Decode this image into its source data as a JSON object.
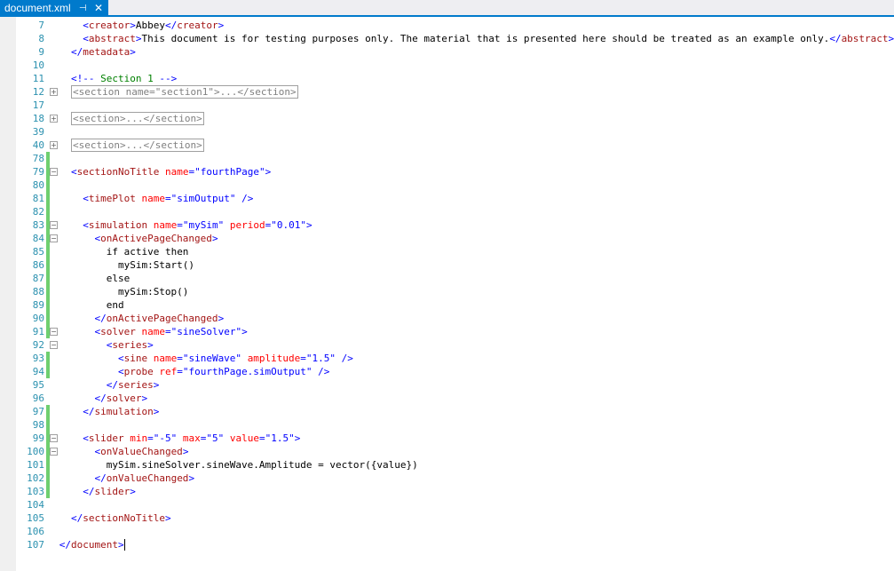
{
  "tab": {
    "title": "document.xml",
    "pin": "⊣",
    "close": "✕"
  },
  "lines": [
    {
      "n": "7",
      "indent": 1,
      "change": false,
      "fold": "",
      "tokens": [
        [
          "br",
          "<"
        ],
        [
          "tag",
          "creator"
        ],
        [
          "br",
          ">"
        ],
        [
          "txt",
          "Abbey"
        ],
        [
          "br",
          "</"
        ],
        [
          "tag",
          "creator"
        ],
        [
          "br",
          ">"
        ]
      ]
    },
    {
      "n": "8",
      "indent": 1,
      "change": false,
      "fold": "",
      "tokens": [
        [
          "br",
          "<"
        ],
        [
          "tag",
          "abstract"
        ],
        [
          "br",
          ">"
        ],
        [
          "txt",
          "This document is for testing purposes only. The material that is presented here should be treated as an example only."
        ],
        [
          "br",
          "</"
        ],
        [
          "tag",
          "abstract"
        ],
        [
          "br",
          ">"
        ]
      ]
    },
    {
      "n": "9",
      "indent": 0,
      "change": false,
      "fold": "",
      "tokens": [
        [
          "br",
          "</"
        ],
        [
          "tag",
          "metadata"
        ],
        [
          "br",
          ">"
        ]
      ]
    },
    {
      "n": "10",
      "indent": 0,
      "change": false,
      "fold": "",
      "tokens": []
    },
    {
      "n": "11",
      "indent": 0,
      "change": false,
      "fold": "",
      "tokens": [
        [
          "br",
          "<!--"
        ],
        [
          "cmt",
          " Section 1 "
        ],
        [
          "br",
          "-->"
        ]
      ]
    },
    {
      "n": "12",
      "indent": 0,
      "change": false,
      "fold": "+",
      "tokens": [
        [
          "col",
          "<section name=\"section1\">...</section>"
        ]
      ]
    },
    {
      "n": "17",
      "indent": 0,
      "change": false,
      "fold": "",
      "tokens": []
    },
    {
      "n": "18",
      "indent": 0,
      "change": false,
      "fold": "+",
      "tokens": [
        [
          "col",
          "<section>...</section>"
        ]
      ]
    },
    {
      "n": "39",
      "indent": 0,
      "change": false,
      "fold": "",
      "tokens": []
    },
    {
      "n": "40",
      "indent": 0,
      "change": false,
      "fold": "+",
      "tokens": [
        [
          "col",
          "<section>...</section>"
        ]
      ]
    },
    {
      "n": "78",
      "indent": 0,
      "change": true,
      "fold": "",
      "tokens": []
    },
    {
      "n": "79",
      "indent": 0,
      "change": true,
      "fold": "-",
      "tokens": [
        [
          "br",
          "<"
        ],
        [
          "tag",
          "sectionNoTitle"
        ],
        [
          "txt",
          " "
        ],
        [
          "attr",
          "name"
        ],
        [
          "br",
          "="
        ],
        [
          "val",
          "\"fourthPage\""
        ],
        [
          "br",
          ">"
        ]
      ]
    },
    {
      "n": "80",
      "indent": 0,
      "change": true,
      "fold": "",
      "tokens": []
    },
    {
      "n": "81",
      "indent": 1,
      "change": true,
      "fold": "",
      "tokens": [
        [
          "br",
          "<"
        ],
        [
          "tag",
          "timePlot"
        ],
        [
          "txt",
          " "
        ],
        [
          "attr",
          "name"
        ],
        [
          "br",
          "="
        ],
        [
          "val",
          "\"simOutput\""
        ],
        [
          "txt",
          " "
        ],
        [
          "br",
          "/>"
        ]
      ]
    },
    {
      "n": "82",
      "indent": 0,
      "change": true,
      "fold": "",
      "tokens": []
    },
    {
      "n": "83",
      "indent": 1,
      "change": true,
      "fold": "-",
      "tokens": [
        [
          "br",
          "<"
        ],
        [
          "tag",
          "simulation"
        ],
        [
          "txt",
          " "
        ],
        [
          "attr",
          "name"
        ],
        [
          "br",
          "="
        ],
        [
          "val",
          "\"mySim\""
        ],
        [
          "txt",
          " "
        ],
        [
          "attr",
          "period"
        ],
        [
          "br",
          "="
        ],
        [
          "val",
          "\"0.01\""
        ],
        [
          "br",
          ">"
        ]
      ]
    },
    {
      "n": "84",
      "indent": 2,
      "change": true,
      "fold": "-",
      "tokens": [
        [
          "br",
          "<"
        ],
        [
          "tag",
          "onActivePageChanged"
        ],
        [
          "br",
          ">"
        ]
      ]
    },
    {
      "n": "85",
      "indent": 3,
      "change": true,
      "fold": "",
      "tokens": [
        [
          "txt",
          "if active then"
        ]
      ]
    },
    {
      "n": "86",
      "indent": 4,
      "change": true,
      "fold": "",
      "tokens": [
        [
          "txt",
          "mySim:Start()"
        ]
      ]
    },
    {
      "n": "87",
      "indent": 3,
      "change": true,
      "fold": "",
      "tokens": [
        [
          "txt",
          "else"
        ]
      ]
    },
    {
      "n": "88",
      "indent": 4,
      "change": true,
      "fold": "",
      "tokens": [
        [
          "txt",
          "mySim:Stop()"
        ]
      ]
    },
    {
      "n": "89",
      "indent": 3,
      "change": true,
      "fold": "",
      "tokens": [
        [
          "txt",
          "end"
        ]
      ]
    },
    {
      "n": "90",
      "indent": 2,
      "change": true,
      "fold": "",
      "tokens": [
        [
          "br",
          "</"
        ],
        [
          "tag",
          "onActivePageChanged"
        ],
        [
          "br",
          ">"
        ]
      ]
    },
    {
      "n": "91",
      "indent": 2,
      "change": true,
      "fold": "-",
      "tokens": [
        [
          "br",
          "<"
        ],
        [
          "tag",
          "solver"
        ],
        [
          "txt",
          " "
        ],
        [
          "attr",
          "name"
        ],
        [
          "br",
          "="
        ],
        [
          "val",
          "\"sineSolver\""
        ],
        [
          "br",
          ">"
        ]
      ]
    },
    {
      "n": "92",
      "indent": 3,
      "change": false,
      "fold": "-",
      "tokens": [
        [
          "br",
          "<"
        ],
        [
          "tag",
          "series"
        ],
        [
          "br",
          ">"
        ]
      ]
    },
    {
      "n": "93",
      "indent": 4,
      "change": true,
      "fold": "",
      "tokens": [
        [
          "br",
          "<"
        ],
        [
          "tag",
          "sine"
        ],
        [
          "txt",
          " "
        ],
        [
          "attr",
          "name"
        ],
        [
          "br",
          "="
        ],
        [
          "val",
          "\"sineWave\""
        ],
        [
          "txt",
          " "
        ],
        [
          "attr",
          "amplitude"
        ],
        [
          "br",
          "="
        ],
        [
          "val",
          "\"1.5\""
        ],
        [
          "txt",
          " "
        ],
        [
          "br",
          "/>"
        ]
      ]
    },
    {
      "n": "94",
      "indent": 4,
      "change": true,
      "fold": "",
      "tokens": [
        [
          "br",
          "<"
        ],
        [
          "tag",
          "probe"
        ],
        [
          "txt",
          " "
        ],
        [
          "attr",
          "ref"
        ],
        [
          "br",
          "="
        ],
        [
          "val",
          "\"fourthPage.simOutput\""
        ],
        [
          "txt",
          " "
        ],
        [
          "br",
          "/>"
        ]
      ]
    },
    {
      "n": "95",
      "indent": 3,
      "change": false,
      "fold": "",
      "tokens": [
        [
          "br",
          "</"
        ],
        [
          "tag",
          "series"
        ],
        [
          "br",
          ">"
        ]
      ]
    },
    {
      "n": "96",
      "indent": 2,
      "change": false,
      "fold": "",
      "tokens": [
        [
          "br",
          "</"
        ],
        [
          "tag",
          "solver"
        ],
        [
          "br",
          ">"
        ]
      ]
    },
    {
      "n": "97",
      "indent": 1,
      "change": true,
      "fold": "",
      "tokens": [
        [
          "br",
          "</"
        ],
        [
          "tag",
          "simulation"
        ],
        [
          "br",
          ">"
        ]
      ]
    },
    {
      "n": "98",
      "indent": 0,
      "change": true,
      "fold": "",
      "tokens": []
    },
    {
      "n": "99",
      "indent": 1,
      "change": true,
      "fold": "-",
      "tokens": [
        [
          "br",
          "<"
        ],
        [
          "tag",
          "slider"
        ],
        [
          "txt",
          " "
        ],
        [
          "attr",
          "min"
        ],
        [
          "br",
          "="
        ],
        [
          "val",
          "\"-5\""
        ],
        [
          "txt",
          " "
        ],
        [
          "attr",
          "max"
        ],
        [
          "br",
          "="
        ],
        [
          "val",
          "\"5\""
        ],
        [
          "txt",
          " "
        ],
        [
          "attr",
          "value"
        ],
        [
          "br",
          "="
        ],
        [
          "val",
          "\"1.5\""
        ],
        [
          "br",
          ">"
        ]
      ]
    },
    {
      "n": "100",
      "indent": 2,
      "change": true,
      "fold": "-",
      "tokens": [
        [
          "br",
          "<"
        ],
        [
          "tag",
          "onValueChanged"
        ],
        [
          "br",
          ">"
        ]
      ]
    },
    {
      "n": "101",
      "indent": 3,
      "change": true,
      "fold": "",
      "tokens": [
        [
          "txt",
          "mySim.sineSolver.sineWave.Amplitude = vector({value})"
        ]
      ]
    },
    {
      "n": "102",
      "indent": 2,
      "change": true,
      "fold": "",
      "tokens": [
        [
          "br",
          "</"
        ],
        [
          "tag",
          "onValueChanged"
        ],
        [
          "br",
          ">"
        ]
      ]
    },
    {
      "n": "103",
      "indent": 1,
      "change": true,
      "fold": "",
      "tokens": [
        [
          "br",
          "</"
        ],
        [
          "tag",
          "slider"
        ],
        [
          "br",
          ">"
        ]
      ]
    },
    {
      "n": "104",
      "indent": 0,
      "change": false,
      "fold": "",
      "tokens": []
    },
    {
      "n": "105",
      "indent": 0,
      "change": false,
      "fold": "",
      "tokens": [
        [
          "br",
          "</"
        ],
        [
          "tag",
          "sectionNoTitle"
        ],
        [
          "br",
          ">"
        ]
      ]
    },
    {
      "n": "106",
      "indent": 0,
      "change": false,
      "fold": "",
      "tokens": []
    },
    {
      "n": "107",
      "indent": -1,
      "change": false,
      "fold": "",
      "tokens": [
        [
          "br",
          "</"
        ],
        [
          "tag",
          "document"
        ],
        [
          "br",
          ">"
        ]
      ],
      "caret": true
    }
  ]
}
